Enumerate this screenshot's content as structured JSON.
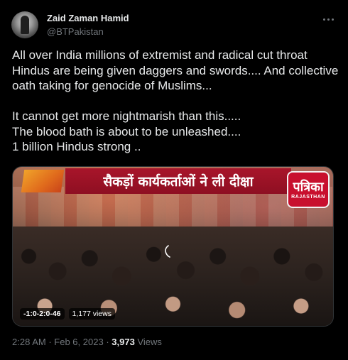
{
  "author": {
    "name": "Zaid Zaman Hamid",
    "handle": "@BTPakistan"
  },
  "tweet": {
    "text": "All over India millions of extremist and radical cut throat Hindus are being given daggers and swords.... And collective oath taking for genocide of Muslims...\n\nIt cannot get more nightmarish than this.....\nThe blood bath is about to be unleashed....\n1 billion Hindus strong .."
  },
  "media": {
    "banner_text": "सैकड़ों कार्यकर्ताओं ने ली दीक्षा",
    "logo_text": "पत्रिका",
    "logo_subtext": "RAJASTHAN",
    "duration": "-1:0-2:0-46",
    "views": "1,177 views"
  },
  "meta": {
    "time": "2:28 AM",
    "separator": "·",
    "date": "Feb 6, 2023",
    "views_count": "3,973",
    "views_label": "Views"
  },
  "icons": {
    "more": "more-horizontal-icon",
    "cursor": "cursor-icon"
  },
  "colors": {
    "background": "#000000",
    "text": "#e7e9ea",
    "secondary": "#71767b",
    "banner": "#a8152a",
    "logo": "#c8102e"
  }
}
